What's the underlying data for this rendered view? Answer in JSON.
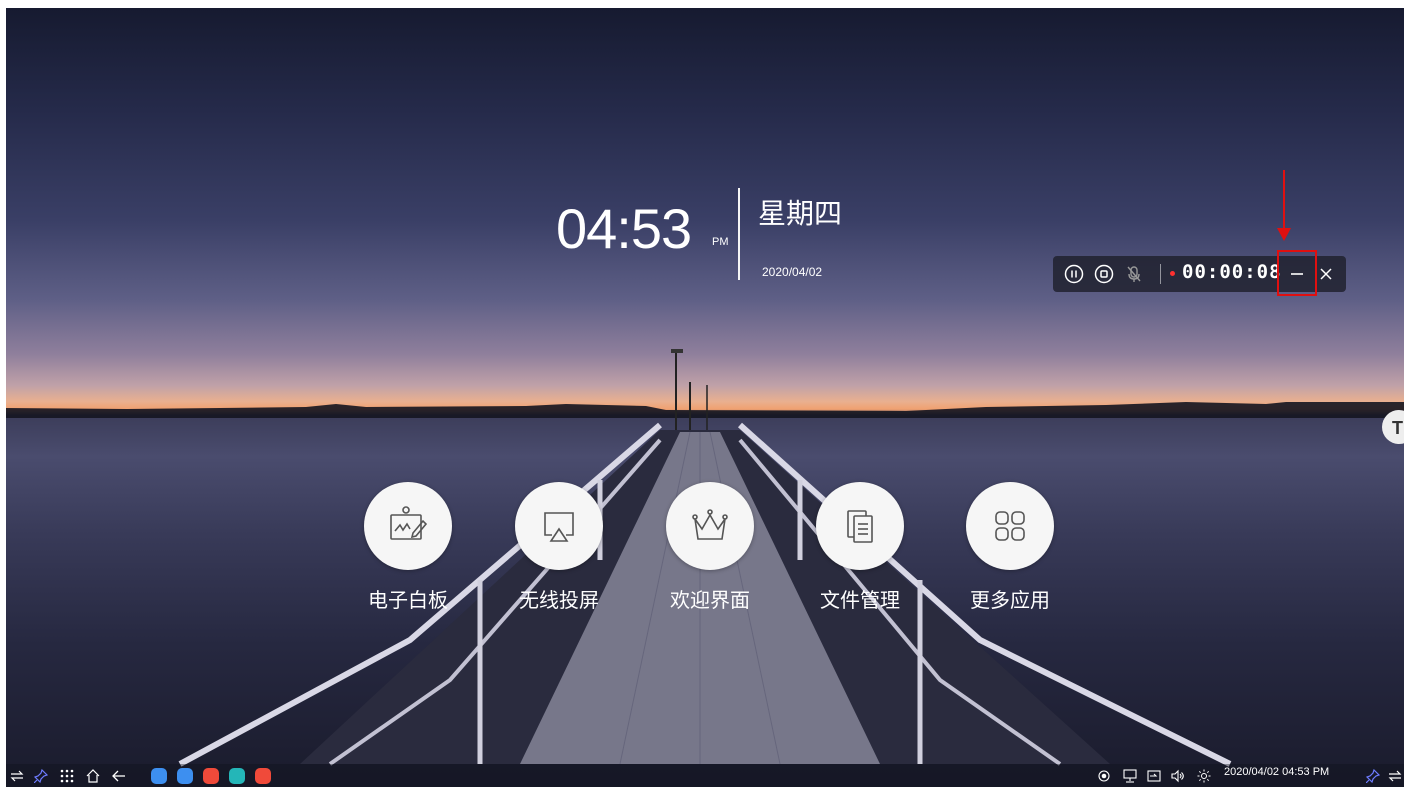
{
  "clock": {
    "time": "04:53",
    "ampm": "PM",
    "weekday": "星期四",
    "date": "2020/04/02"
  },
  "apps": [
    {
      "label": "电子白板",
      "icon": "whiteboard-icon"
    },
    {
      "label": "无线投屏",
      "icon": "screen-cast-icon"
    },
    {
      "label": "欢迎界面",
      "icon": "crown-icon"
    },
    {
      "label": "文件管理",
      "icon": "file-manager-icon"
    },
    {
      "label": "更多应用",
      "icon": "more-apps-icon"
    }
  ],
  "recorder": {
    "elapsed": "00:00:08",
    "controls": [
      "pause-icon",
      "stop-icon",
      "microphone-muted-icon",
      "minimize-icon",
      "close-icon"
    ]
  },
  "taskbar": {
    "left_icons": [
      "swap-icon",
      "pin-icon",
      "apps-grid-icon",
      "home-icon",
      "back-icon"
    ],
    "pinned_apps": [
      {
        "icon": "settings-app-icon",
        "color": "#3d8ff0"
      },
      {
        "icon": "cast-app-icon",
        "color": "#3d8ff0"
      },
      {
        "icon": "browser-app-icon",
        "color": "#f04a3a"
      },
      {
        "icon": "notes-app-icon",
        "color": "#24b6b8"
      },
      {
        "icon": "toolbox-app-icon",
        "color": "#f04a3a"
      }
    ],
    "status_icons": [
      "record-indicator-icon",
      "display-icon",
      "input-source-icon",
      "volume-icon",
      "brightness-icon"
    ],
    "datetime": "2020/04/02  04:53 PM"
  },
  "colors": {
    "highlight": "#e01010",
    "record_dot": "#ff3030"
  }
}
